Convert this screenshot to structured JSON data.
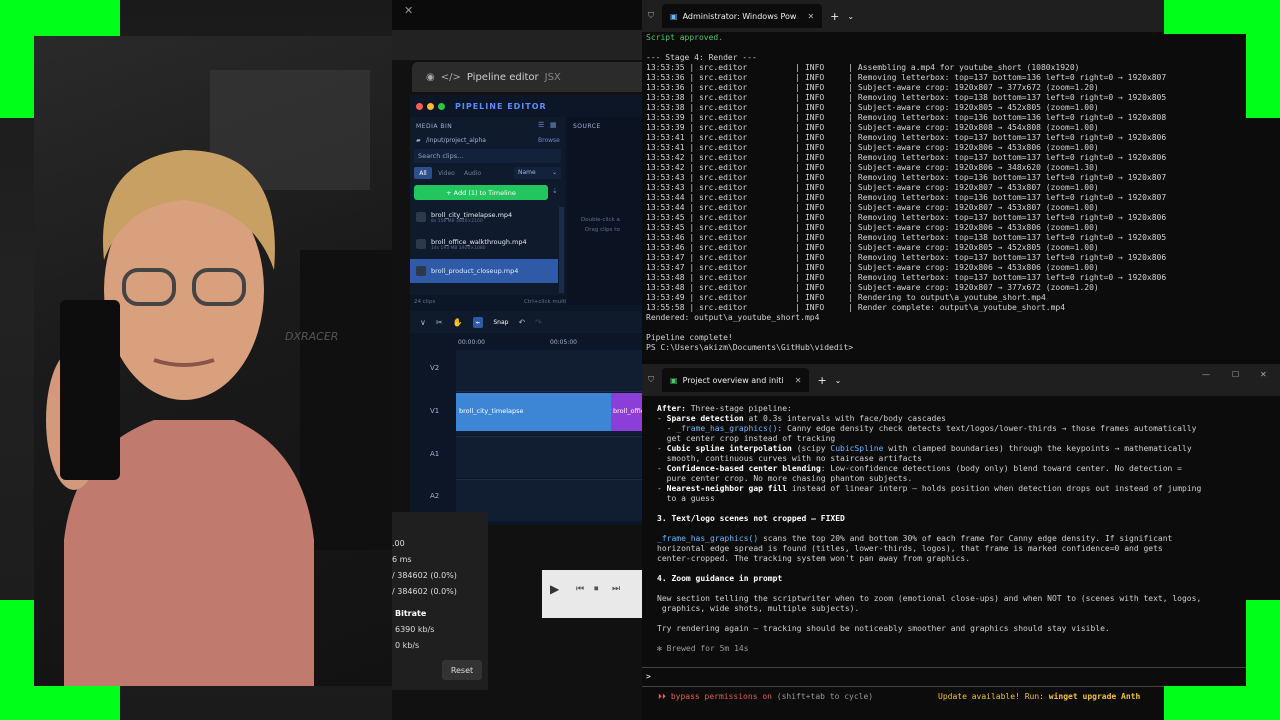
{
  "editor": {
    "title": "Pipeline editor",
    "title_tag": "JSX",
    "header": "PIPELINE EDITOR",
    "media_bin_label": "MEDIA BIN",
    "source_label": "SOURCE",
    "folder_path": "/input/project_alpha",
    "browse_label": "Browse",
    "search_placeholder": "Search clips...",
    "filters": [
      "All",
      "Video",
      "Audio"
    ],
    "sort_value": "Name",
    "add_button": "+ Add (1) to Timeline",
    "clips": [
      {
        "name": "broll_city_timelapse.mp4",
        "meta": "8s 156 MB 3840×2160"
      },
      {
        "name": "broll_office_walkthrough.mp4",
        "meta": "14s 193 MB 1920×1080"
      },
      {
        "name": "broll_product_closeup.mp4",
        "meta": ""
      }
    ],
    "clip_count": "24 clips",
    "multi_hint": "Ctrl+click multi",
    "source_hint_1": "Double-click a",
    "source_hint_2": "Drag clips to",
    "snap_label": "Snap",
    "time_0": "00:00:00",
    "time_1": "00:05:00",
    "tracks": [
      {
        "id": "V2"
      },
      {
        "id": "V1"
      },
      {
        "id": "A1"
      },
      {
        "id": "A2"
      }
    ],
    "timeline_clip_1": "broll_city_timelapse",
    "timeline_clip_2": "broll_offic"
  },
  "stats": {
    "v1": ".00",
    "v2": "6 ms",
    "v3": "/ 384602 (0.0%)",
    "v4": "/ 384602 (0.0%)",
    "bitrate_label": "Bitrate",
    "bitrate_1": "6390 kb/s",
    "bitrate_2": "0 kb/s",
    "reset_label": "Reset"
  },
  "terminal1": {
    "tab_title": "Administrator: Windows Pow",
    "lines": [
      {
        "text": "Script approved.",
        "cls": "ok"
      },
      {
        "text": "",
        "cls": ""
      },
      {
        "text": "--- Stage 4: Render ---",
        "cls": ""
      },
      {
        "text": "13:53:35 | src.editor          | INFO     | Assembling a.mp4 for youtube_short (1080x1920)",
        "cls": ""
      },
      {
        "text": "13:53:36 | src.editor          | INFO     | Removing letterbox: top=137 bottom=136 left=0 right=0 → 1920x807",
        "cls": ""
      },
      {
        "text": "13:53:36 | src.editor          | INFO     | Subject-aware crop: 1920x807 → 377x672 (zoom=1.20)",
        "cls": ""
      },
      {
        "text": "13:53:38 | src.editor          | INFO     | Removing letterbox: top=138 bottom=137 left=0 right=0 → 1920x805",
        "cls": ""
      },
      {
        "text": "13:53:38 | src.editor          | INFO     | Subject-aware crop: 1920x805 → 452x805 (zoom=1.00)",
        "cls": ""
      },
      {
        "text": "13:53:39 | src.editor          | INFO     | Removing letterbox: top=136 bottom=136 left=0 right=0 → 1920x808",
        "cls": ""
      },
      {
        "text": "13:53:39 | src.editor          | INFO     | Subject-aware crop: 1920x808 → 454x808 (zoom=1.00)",
        "cls": ""
      },
      {
        "text": "13:53:41 | src.editor          | INFO     | Removing letterbox: top=137 bottom=137 left=0 right=0 → 1920x806",
        "cls": ""
      },
      {
        "text": "13:53:41 | src.editor          | INFO     | Subject-aware crop: 1920x806 → 453x806 (zoom=1.00)",
        "cls": ""
      },
      {
        "text": "13:53:42 | src.editor          | INFO     | Removing letterbox: top=137 bottom=137 left=0 right=0 → 1920x806",
        "cls": ""
      },
      {
        "text": "13:53:42 | src.editor          | INFO     | Subject-aware crop: 1920x806 → 348x620 (zoom=1.30)",
        "cls": ""
      },
      {
        "text": "13:53:43 | src.editor          | INFO     | Removing letterbox: top=136 bottom=137 left=0 right=0 → 1920x807",
        "cls": ""
      },
      {
        "text": "13:53:43 | src.editor          | INFO     | Subject-aware crop: 1920x807 → 453x807 (zoom=1.00)",
        "cls": ""
      },
      {
        "text": "13:53:44 | src.editor          | INFO     | Removing letterbox: top=136 bottom=137 left=0 right=0 → 1920x807",
        "cls": ""
      },
      {
        "text": "13:53:44 | src.editor          | INFO     | Subject-aware crop: 1920x807 → 453x807 (zoom=1.00)",
        "cls": ""
      },
      {
        "text": "13:53:45 | src.editor          | INFO     | Removing letterbox: top=137 bottom=137 left=0 right=0 → 1920x806",
        "cls": ""
      },
      {
        "text": "13:53:45 | src.editor          | INFO     | Subject-aware crop: 1920x806 → 453x806 (zoom=1.00)",
        "cls": ""
      },
      {
        "text": "13:53:46 | src.editor          | INFO     | Removing letterbox: top=138 bottom=137 left=0 right=0 → 1920x805",
        "cls": ""
      },
      {
        "text": "13:53:46 | src.editor          | INFO     | Subject-aware crop: 1920x805 → 452x805 (zoom=1.00)",
        "cls": ""
      },
      {
        "text": "13:53:47 | src.editor          | INFO     | Removing letterbox: top=137 bottom=137 left=0 right=0 → 1920x806",
        "cls": ""
      },
      {
        "text": "13:53:47 | src.editor          | INFO     | Subject-aware crop: 1920x806 → 453x806 (zoom=1.00)",
        "cls": ""
      },
      {
        "text": "13:53:48 | src.editor          | INFO     | Removing letterbox: top=137 bottom=137 left=0 right=0 → 1920x806",
        "cls": ""
      },
      {
        "text": "13:53:48 | src.editor          | INFO     | Subject-aware crop: 1920x807 → 377x672 (zoom=1.20)",
        "cls": ""
      },
      {
        "text": "13:53:49 | src.editor          | INFO     | Rendering to output\\a_youtube_short.mp4",
        "cls": ""
      },
      {
        "text": "13:55:58 | src.editor          | INFO     | Render complete: output\\a_youtube_short.mp4",
        "cls": ""
      },
      {
        "text": "Rendered: output\\a_youtube_short.mp4",
        "cls": ""
      },
      {
        "text": "",
        "cls": ""
      },
      {
        "text": "Pipeline complete!",
        "cls": ""
      },
      {
        "text": "PS C:\\Users\\akizm\\Documents\\GitHub\\videdit>",
        "cls": ""
      }
    ]
  },
  "terminal2": {
    "tab_title": "Project overview and initi",
    "after_label": "After:",
    "after_text": " Three-stage pipeline:",
    "lines": [
      {
        "pre": "- ",
        "b": "Sparse detection",
        "rest": " at 0.3s intervals with face/body cascades"
      },
      {
        "pre": "  - ",
        "c": "_frame_has_graphics()",
        "rest": ": Canny edge density check detects text/logos/lower-thirds → those frames automatically"
      },
      {
        "pre": "",
        "rest": "  get center crop instead of tracking"
      },
      {
        "pre": "- ",
        "b": "Cubic spline interpolation",
        "rest": " (scipy ",
        "c2": "CubicSpline",
        "rest2": " with clamped boundaries) through the keypoints → mathematically"
      },
      {
        "pre": "",
        "rest": "  smooth, continuous curves with no staircase artifacts"
      },
      {
        "pre": "- ",
        "b": "Confidence-based center blending",
        "rest": ": Low-confidence detections (body only) blend toward center. No detection ="
      },
      {
        "pre": "",
        "rest": "  pure center crop. No more chasing phantom subjects."
      },
      {
        "pre": "- ",
        "b": "Nearest-neighbor gap fill",
        "rest": " instead of linear interp — holds position when detection drops out instead of jumping"
      },
      {
        "pre": "",
        "rest": "  to a guess"
      }
    ],
    "section3": "3. Text/logo scenes not cropped — FIXED",
    "s3_l1_code": "_frame_has_graphics()",
    "s3_l1": " scans the top 20% and bottom 30% of each frame for Canny edge density. If significant",
    "s3_l2": "horizontal edge spread is found (titles, lower-thirds, logos), that frame is marked confidence=0 and gets",
    "s3_l3": "center-cropped. The tracking system won't pan away from graphics.",
    "section4": "4. Zoom guidance in prompt",
    "s4_l1": "New section telling the scriptwriter when to zoom (emotional close-ups) and when NOT to (scenes with text, logos,",
    "s4_l2": " graphics, wide shots, multiple subjects).",
    "closing": "Try rendering again — tracking should be noticeably smoother and graphics should stay visible.",
    "brewed": "✻ Brewed for 5m 14s",
    "prompt": ">",
    "bypass_1": "⏵⏵ bypass permissions on",
    "bypass_2": " (shift+tab to cycle)",
    "update_1": "Update available! Run: ",
    "update_2": "winget upgrade Anth"
  }
}
